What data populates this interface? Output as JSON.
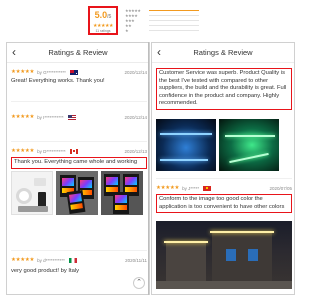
{
  "summary": {
    "score": "5.0",
    "score_suffix": "/5",
    "stars": "★★★★★",
    "count_label": "11 ratings",
    "rows": [
      {
        "stars": "★★★★★",
        "fill": 1.0
      },
      {
        "stars": "★★★★",
        "fill": 0.0
      },
      {
        "stars": "★★★",
        "fill": 0.0
      },
      {
        "stars": "★★",
        "fill": 0.0
      },
      {
        "stars": "★",
        "fill": 0.0
      }
    ]
  },
  "left_panel": {
    "back_icon": "chevron-left-icon",
    "title": "Ratings & Review",
    "reviews": [
      {
        "stars": "★★★★★",
        "user": "by G***********",
        "country": "AU",
        "date": "2020/12/14",
        "text": "Great! Everything works. Thank you!"
      },
      {
        "stars": "★★★★★",
        "user": "by I***********",
        "country": "US",
        "date": "2020/12/14",
        "text": ""
      },
      {
        "stars": "★★★★★",
        "user": "by D***********",
        "country": "CA",
        "date": "2020/12/13",
        "text": "Thank you. Everything came whole and working"
      },
      {
        "stars": "★★★★★",
        "user": "by d***********",
        "country": "IT",
        "date": "2020/11/11",
        "text": "very good product! by Italy"
      }
    ]
  },
  "right_panel": {
    "back_icon": "chevron-left-icon",
    "title": "Ratings & Review",
    "reviews": [
      {
        "text": "Customer Service was superb. Product Quality is the best I've tested with compared to other suppliers, the build and the durability is great. Full confidence in the product and company. Highly recommended."
      },
      {
        "stars": "★★★★★",
        "user": "by J*****",
        "country": "VN",
        "date": "2020/07/05",
        "text": "Conform to the image too good color the application is too convenient to have other colors"
      }
    ]
  },
  "colors": {
    "highlight": "#e8141a",
    "star": "#f29a1f"
  }
}
